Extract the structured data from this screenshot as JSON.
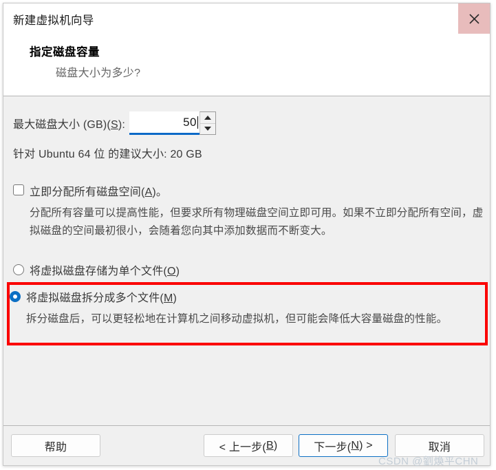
{
  "window": {
    "title": "新建虚拟机向导",
    "close_icon": "close-icon"
  },
  "header": {
    "title": "指定磁盘容量",
    "subtitle": "磁盘大小为多少?"
  },
  "disk_size": {
    "label": "最大磁盘大小 (GB)(S):",
    "label_plain": "最大磁盘大小 (GB)(",
    "label_accel": "S",
    "label_tail": "):",
    "value": "50",
    "spin_up_icon": "triangle-up-icon",
    "spin_down_icon": "triangle-down-icon",
    "hint": "针对 Ubuntu 64 位 的建议大小: 20 GB"
  },
  "allocate_option": {
    "checked": false,
    "label_plain": "立即分配所有磁盘空间(",
    "label_accel": "A",
    "label_tail": ")。",
    "description": "分配所有容量可以提高性能，但要求所有物理磁盘空间立即可用。如果不立即分配所有空间，虚拟磁盘的空间最初很小，会随着您向其中添加数据而不断变大。"
  },
  "storage_options": [
    {
      "selected": false,
      "label_plain": "将虚拟磁盘存储为单个文件(",
      "label_accel": "O",
      "label_tail": ")",
      "description": ""
    },
    {
      "selected": true,
      "label_plain": "将虚拟磁盘拆分成多个文件(",
      "label_accel": "M",
      "label_tail": ")",
      "description": "拆分磁盘后，可以更轻松地在计算机之间移动虚拟机，但可能会降低大容量磁盘的性能。"
    }
  ],
  "footer": {
    "help": "帮助",
    "back_plain": "< 上一步(",
    "back_accel": "B",
    "back_tail": ")",
    "next_plain": "下一步(",
    "next_accel": "N",
    "next_tail": ") >",
    "cancel": "取消"
  },
  "watermark": "CSDN @劉煥平CHN",
  "colors": {
    "accent": "#0b6fc4",
    "highlight_box": "#fb0000",
    "close_hover": "#e8bcbc",
    "body_bg": "#f0f0f0"
  }
}
